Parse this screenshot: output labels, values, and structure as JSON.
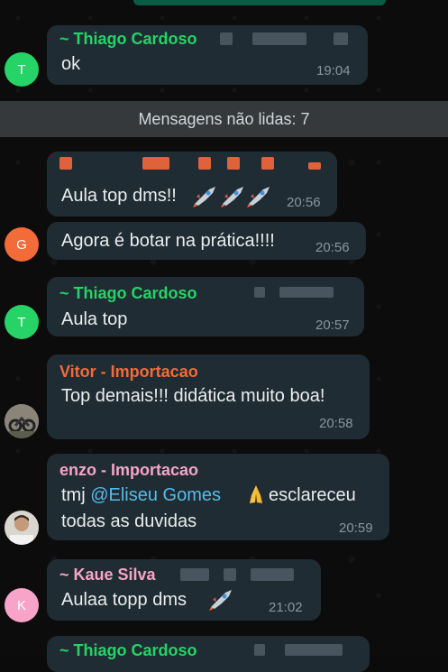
{
  "colors": {
    "bubble": "#202c33",
    "name_green": "#25d366",
    "name_orange": "#f26b38",
    "name_pink": "#f7a4c8",
    "unread_banner": "#36393b",
    "mention": "#53bdeb"
  },
  "unread_banner": "Mensagens não lidas: 7",
  "messages": [
    {
      "sender": "~ Thiago Cardoso",
      "text": "ok",
      "time": "19:04",
      "avatar": "T"
    },
    {
      "sender": "",
      "text": "Aula top dms!!",
      "emoji": "rocket rocket rocket",
      "time": "20:56"
    },
    {
      "sender": "",
      "text": "Agora é botar na prática!!!!",
      "time": "20:56",
      "avatar": "G"
    },
    {
      "sender": "~ Thiago Cardoso",
      "text": "Aula top",
      "time": "20:57",
      "avatar": "T"
    },
    {
      "sender": "Vitor - Importacao",
      "text": "Top demais!!! didática muito boa!",
      "time": "20:58"
    },
    {
      "sender": "enzo - Importacao",
      "text_before": "tmj ",
      "mention": "@Eliseu Gomes",
      "text_after": " esclareceu",
      "text_line2": "todas as duvidas",
      "time": "20:59"
    },
    {
      "sender": "~ Kaue Silva",
      "text": "Aulaa topp dms",
      "time": "21:02",
      "avatar": "K"
    },
    {
      "sender": "~ Thiago Cardoso"
    }
  ]
}
